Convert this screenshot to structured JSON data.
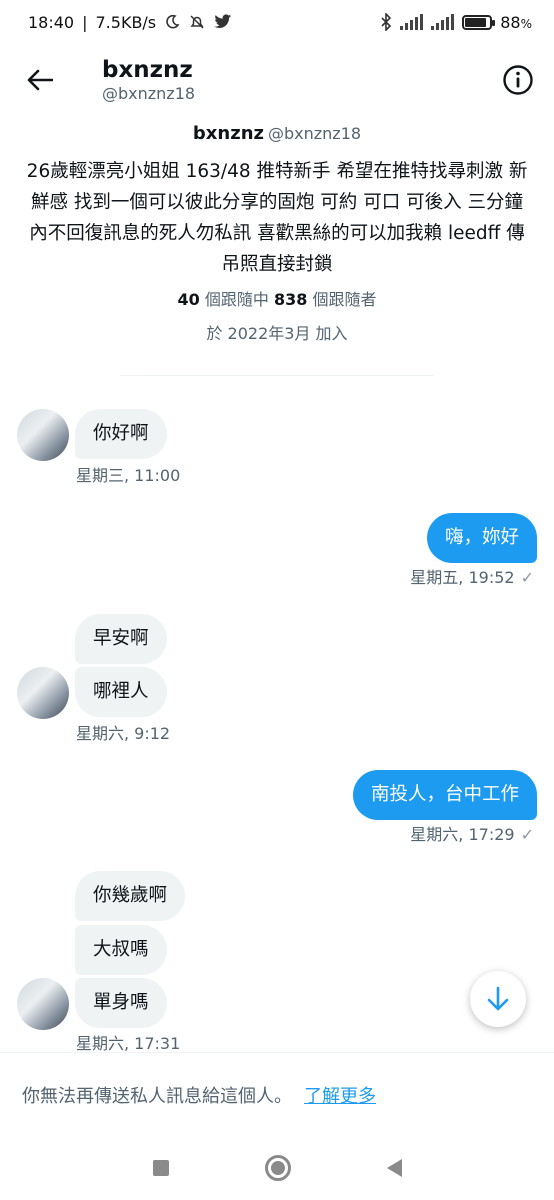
{
  "status_bar": {
    "time": "18:40",
    "speed": "7.5KB/s",
    "battery": "88",
    "battery_level": 0.88,
    "network": "4G"
  },
  "header": {
    "name": "bxnznz",
    "handle": "@bxnznz18"
  },
  "profile": {
    "name": "bxnznz",
    "handle": "@bxnznz18",
    "bio": "26歲輕漂亮小姐姐 163/48 推特新手 希望在推特找尋刺激 新鮮感 找到一個可以彼此分享的固炮 可約  可口  可後入 三分鐘內不回復訊息的死人勿私訊 喜歡黑絲的可以加我賴 leedff 傳吊照直接封鎖",
    "following_count": "40",
    "following_label": "個跟隨中",
    "followers_count": "838",
    "followers_label": "個跟隨者",
    "joined": "於 2022年3月 加入"
  },
  "messages": {
    "m1": "你好啊",
    "t1": "星期三, 11:00",
    "m2": "嗨，妳好",
    "t2": "星期五, 19:52",
    "m3": "早安啊",
    "m4": "哪裡人",
    "t3": "星期六, 9:12",
    "m5": "南投人，台中工作",
    "t4": "星期六, 17:29",
    "m6": "你幾歲啊",
    "m7": "大叔嗎",
    "m8": "單身嗎",
    "t5": "星期六, 17:31"
  },
  "footer": {
    "notice": "你無法再傳送私人訊息給這個人。",
    "learn_more": "了解更多"
  },
  "colors": {
    "accent": "#1d9bf0",
    "incoming_bubble": "#eff3f4",
    "secondary_text": "#536471"
  }
}
